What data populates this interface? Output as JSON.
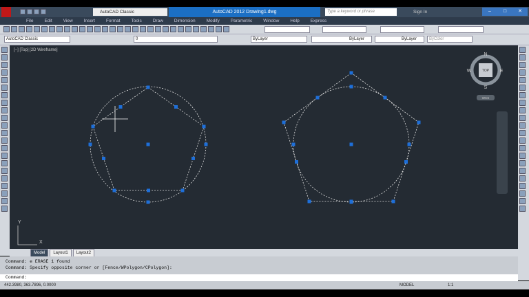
{
  "app": {
    "title": "AutoCAD 2012   Drawing1.dwg",
    "workspace": "AutoCAD Classic",
    "search_placeholder": "Type a keyword or phrase",
    "sign_in": "Sign In"
  },
  "menu": [
    "File",
    "Edit",
    "View",
    "Insert",
    "Format",
    "Tools",
    "Draw",
    "Dimension",
    "Modify",
    "Parametric",
    "Window",
    "Help",
    "Express"
  ],
  "layers": {
    "workspace": "AutoCAD Classic",
    "layer": "0",
    "color": "ByLayer",
    "linetype": "ByLayer",
    "lineweight": "ByLayer",
    "plotstyle": "ByColor"
  },
  "viewport": {
    "label": "[−] [Top] [2D Wireframe]",
    "viewcube": {
      "n": "N",
      "s": "S",
      "e": "E",
      "w": "W",
      "top": "TOP",
      "wcs": "WCS"
    },
    "ucs_x": "X",
    "ucs_y": "Y"
  },
  "tabs": [
    "Model",
    "Layout1",
    "Layout2"
  ],
  "command": {
    "history": [
      "Command: e ERASE 1 found",
      "Command: Specify opposite corner or [Fence/WPolygon/CPolygon]:"
    ],
    "prompt": "Command:"
  },
  "status": {
    "coords": "442.3980, 363.7896, 0.0000",
    "model": "MODEL",
    "scale": "1:1"
  },
  "colors": {
    "canvas": "#242b33",
    "grip": "#1e6fd9",
    "title_accent": "#1b6fc4"
  }
}
